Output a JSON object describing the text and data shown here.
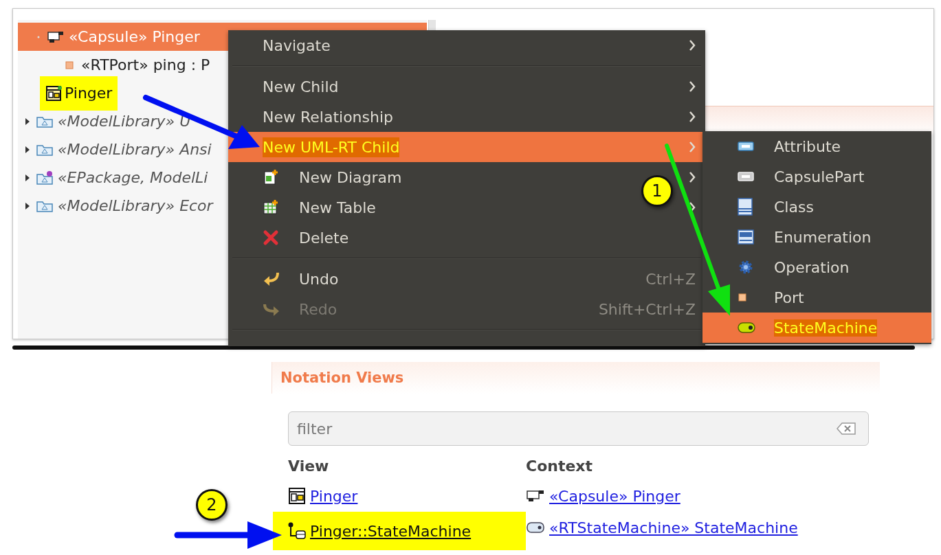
{
  "tree": {
    "items": [
      {
        "label": "«Capsule» Pinger",
        "kind": "element",
        "expanded": true,
        "selected": true,
        "children": [
          {
            "label": "«RTPort» ping : P",
            "selected": false,
            "highlighted": false
          },
          {
            "label": "Pinger",
            "selected": false,
            "highlighted": true
          }
        ]
      },
      {
        "label": "«ModelLibrary» U",
        "kind": "library",
        "expanded": false,
        "selected": false
      },
      {
        "label": "«ModelLibrary» Ansi",
        "kind": "library",
        "expanded": false,
        "selected": false
      },
      {
        "label": "«EPackage, ModelLi",
        "kind": "library",
        "expanded": false,
        "selected": false
      },
      {
        "label": "«ModelLibrary» Ecor",
        "kind": "library",
        "expanded": false,
        "selected": false
      }
    ]
  },
  "context_menu": {
    "items": [
      {
        "kind": "item",
        "label": "Navigate",
        "submenu": true,
        "selected": false,
        "disabled": false
      },
      {
        "kind": "separator"
      },
      {
        "kind": "item",
        "label": "New Child",
        "submenu": true,
        "selected": false,
        "disabled": false
      },
      {
        "kind": "item",
        "label": "New Relationship",
        "submenu": true,
        "selected": false,
        "disabled": false
      },
      {
        "kind": "item",
        "label": "New UML-RT Child",
        "submenu": true,
        "selected": true,
        "disabled": false
      },
      {
        "kind": "item",
        "label": "New Diagram",
        "submenu": true,
        "selected": false,
        "disabled": false
      },
      {
        "kind": "item",
        "label": "New Table",
        "submenu": true,
        "selected": false,
        "disabled": false
      },
      {
        "kind": "item",
        "label": "Delete",
        "submenu": false,
        "selected": false,
        "disabled": false
      },
      {
        "kind": "separator"
      },
      {
        "kind": "item",
        "label": "Undo",
        "shortcut": "Ctrl+Z",
        "submenu": false,
        "selected": false,
        "disabled": false
      },
      {
        "kind": "item",
        "label": "Redo",
        "shortcut": "Shift+Ctrl+Z",
        "submenu": false,
        "selected": false,
        "disabled": true
      },
      {
        "kind": "separator"
      }
    ]
  },
  "submenu": {
    "items": [
      {
        "label": "Attribute",
        "selected": false
      },
      {
        "label": "CapsulePart",
        "selected": false
      },
      {
        "label": "Class",
        "selected": false
      },
      {
        "label": "Enumeration",
        "selected": false
      },
      {
        "label": "Operation",
        "selected": false
      },
      {
        "label": "Port",
        "selected": false
      },
      {
        "label": "StateMachine",
        "selected": true
      }
    ]
  },
  "notation_views": {
    "title": "Notation Views",
    "filter": {
      "placeholder": "filter"
    },
    "columns": [
      "View",
      "Context"
    ],
    "rows": [
      {
        "view": "Pinger",
        "context": "«Capsule» Pinger",
        "highlighted": false
      },
      {
        "view": "Pinger::StateMachine",
        "context": "«RTStateMachine» StateMachine",
        "highlighted": true
      }
    ]
  },
  "annotations": {
    "badges": [
      {
        "label": "1"
      },
      {
        "label": "2"
      }
    ]
  }
}
